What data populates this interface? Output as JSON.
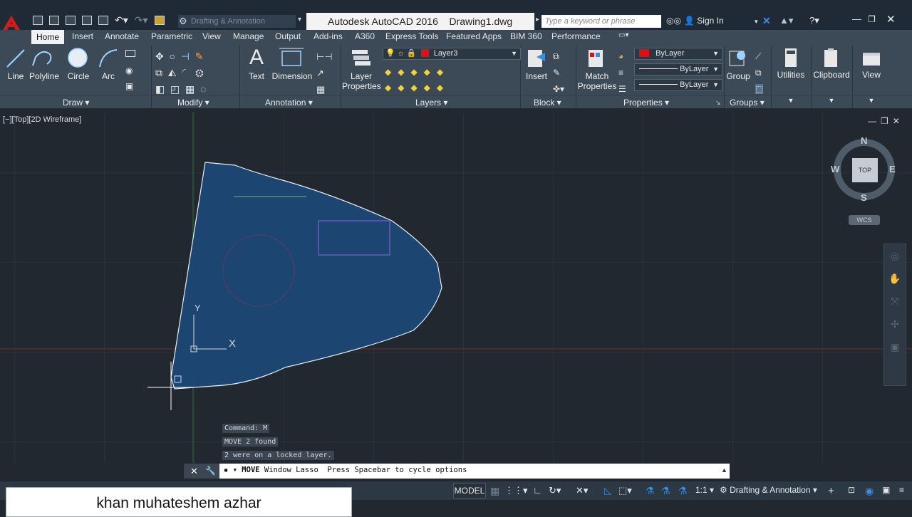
{
  "app": {
    "title": "Autodesk AutoCAD 2016",
    "filename": "Drawing1.dwg",
    "workspace_combo": "Drafting & Annotation"
  },
  "search": {
    "placeholder": "Type a keyword or phrase"
  },
  "account": {
    "sign_in": "Sign In"
  },
  "tabs": [
    "Home",
    "Insert",
    "Annotate",
    "Parametric",
    "View",
    "Manage",
    "Output",
    "Add-ins",
    "A360",
    "Express Tools",
    "Featured Apps",
    "BIM 360",
    "Performance"
  ],
  "ribbon": {
    "draw": {
      "title": "Draw",
      "tools": [
        "Line",
        "Polyline",
        "Circle",
        "Arc"
      ]
    },
    "modify": {
      "title": "Modify"
    },
    "annotation": {
      "title": "Annotation",
      "tools": [
        "Text",
        "Dimension"
      ]
    },
    "layers": {
      "title": "Layers",
      "layer_props": "Layer\nProperties",
      "current_layer": "Layer3"
    },
    "block": {
      "title": "Block",
      "insert": "Insert"
    },
    "properties": {
      "title": "Properties",
      "match": "Match\nProperties",
      "color": "ByLayer",
      "linetype": "ByLayer",
      "lineweight": "ByLayer"
    },
    "groups": {
      "title": "Groups",
      "group": "Group"
    },
    "utilities": "Utilities",
    "clipboard": "Clipboard",
    "view": "View"
  },
  "viewport": {
    "label": "[−][Top][2D Wireframe]"
  },
  "viewcube": {
    "n": "N",
    "s": "S",
    "e": "E",
    "w": "W",
    "top": "TOP",
    "wcs": "WCS"
  },
  "ucs": {
    "x": "X",
    "y": "Y"
  },
  "command": {
    "history": [
      "Command: M",
      "MOVE 2 found",
      "2 were on a locked layer."
    ],
    "prompt_cmd": "MOVE",
    "prompt_rest": " Window Lasso  Press Spacebar to cycle options"
  },
  "status": {
    "model": "MODEL",
    "scale": "1:1",
    "workspace": "Drafting & Annotation"
  },
  "footer": {
    "text": "khan muhateshem azhar"
  },
  "colors": {
    "layer3": "#e01010",
    "selection_fill": "#1d4775",
    "bylayer_swatch": "#e01010"
  }
}
